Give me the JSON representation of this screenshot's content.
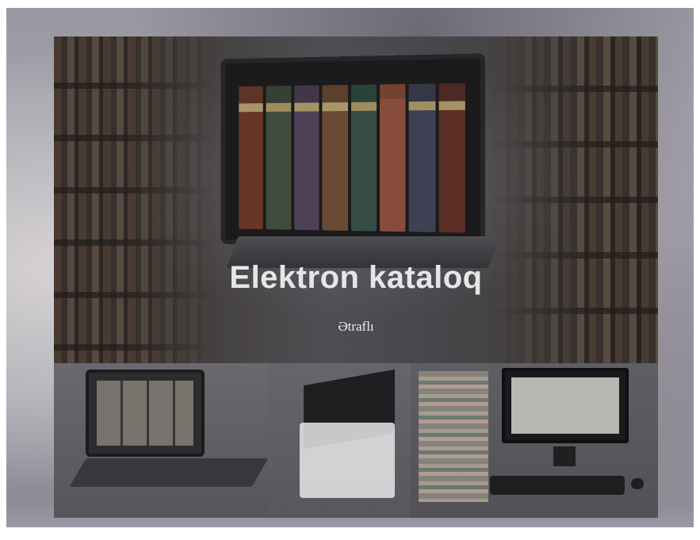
{
  "hero": {
    "title": "Elektron kataloq",
    "link_label": "Ətraflı"
  },
  "colors": {
    "title_text": "#e6e6e8",
    "link_text": "#ececec",
    "card_bg": "#2b2b2e",
    "strip_bg": "#5c5b60"
  },
  "images": {
    "hero": "laptop-with-books-in-library",
    "thumb_1": "laptop-card-catalog",
    "thumb_2": "book-scanner",
    "thumb_3": "desktop-computer-with-book-stack"
  }
}
